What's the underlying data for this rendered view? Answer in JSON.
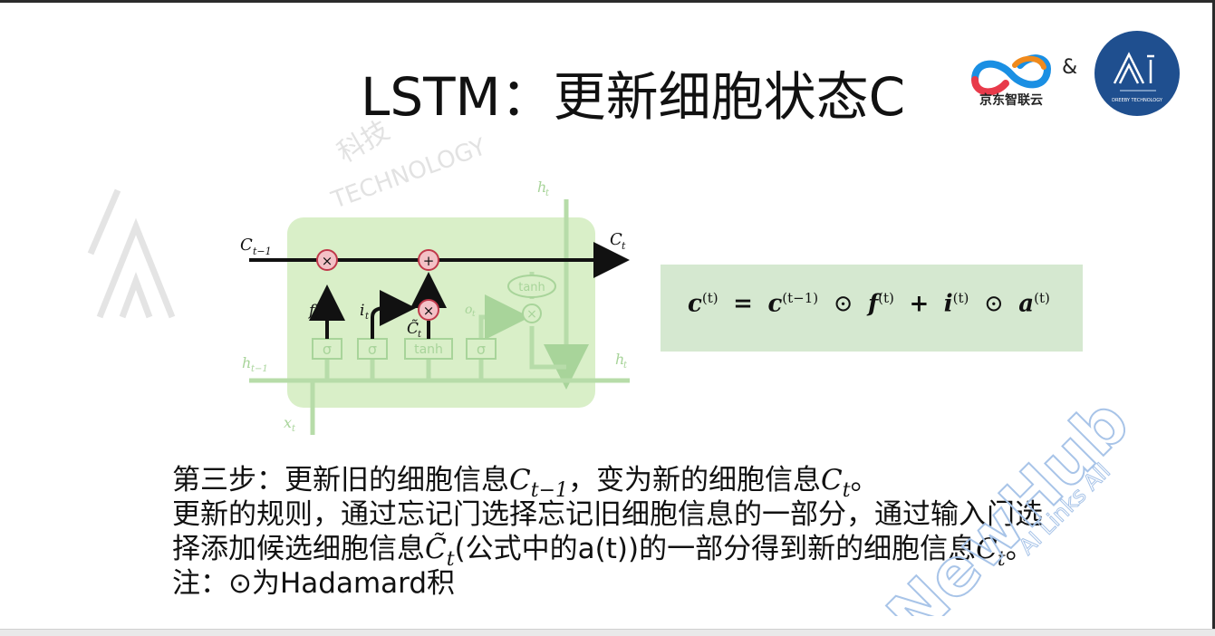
{
  "slide": {
    "title": "LSTM：更新细胞状态C",
    "logos": {
      "partner_text": "京东智联云",
      "ampersand": "&",
      "ai_logo_name": "Ai",
      "ai_logo_subtitle": "DREEBY TECHNOLOGY",
      "partner_color": "#1a8fe3",
      "ai_color": "#1f4f8f"
    },
    "diagram": {
      "labels": {
        "c_prev": "C",
        "c_prev_sub": "t−1",
        "c_out": "C",
        "c_out_sub": "t",
        "h_top": "h",
        "h_top_sub": "t",
        "h_prev": "h",
        "h_prev_sub": "t−1",
        "h_out": "h",
        "h_out_sub": "t",
        "x_in": "x",
        "x_in_sub": "t",
        "f": "f",
        "f_sub": "t",
        "i": "i",
        "i_sub": "t",
        "o": "o",
        "o_sub": "t",
        "c_tilde": "C̃",
        "c_tilde_sub": "t",
        "gate_sigma": "σ",
        "gate_tanh": "tanh",
        "op_multiply": "×",
        "op_add": "+"
      },
      "colors": {
        "cell_fill": "#d9efc8",
        "faded": "#a8d49a",
        "op_fill": "#f3c1c6"
      }
    },
    "formula": {
      "lhs": "c",
      "lhs_sup": "(t)",
      "eq": "=",
      "c_prev": "c",
      "c_prev_sup": "(t−1)",
      "odot": "⊙",
      "f": "f",
      "f_sup": "(t)",
      "plus": "+",
      "i": "i",
      "i_sup": "(t)",
      "odot2": "⊙",
      "a": "a",
      "a_sup": "(t)",
      "box_color": "#d5e8d0"
    },
    "text": {
      "line1_a": "第三步：更新旧的细胞信息",
      "line1_c": "C",
      "line1_c_sub": "t−1",
      "line1_b": "，变为新的细胞信息",
      "line1_c2": "C",
      "line1_c2_sub": "t",
      "line1_end": "。",
      "line2": "更新的规则，通过忘记门选择忘记旧细胞信息的一部分，通过输入门选",
      "line3_a": "择添加候选细胞信息",
      "line3_c": "C̃",
      "line3_c_sub": "t",
      "line3_b": "(公式中的a(t))的一部分得到新的细胞信息",
      "line3_c2": "C",
      "line3_c2_sub": "t",
      "line3_end": "。",
      "line4": "注：⊙为Hadamard积"
    },
    "watermarks": {
      "center": "科技",
      "center2": "TECHNOLOGY",
      "newhub": "NewHub",
      "newhub_sub": "AI Links All"
    }
  }
}
